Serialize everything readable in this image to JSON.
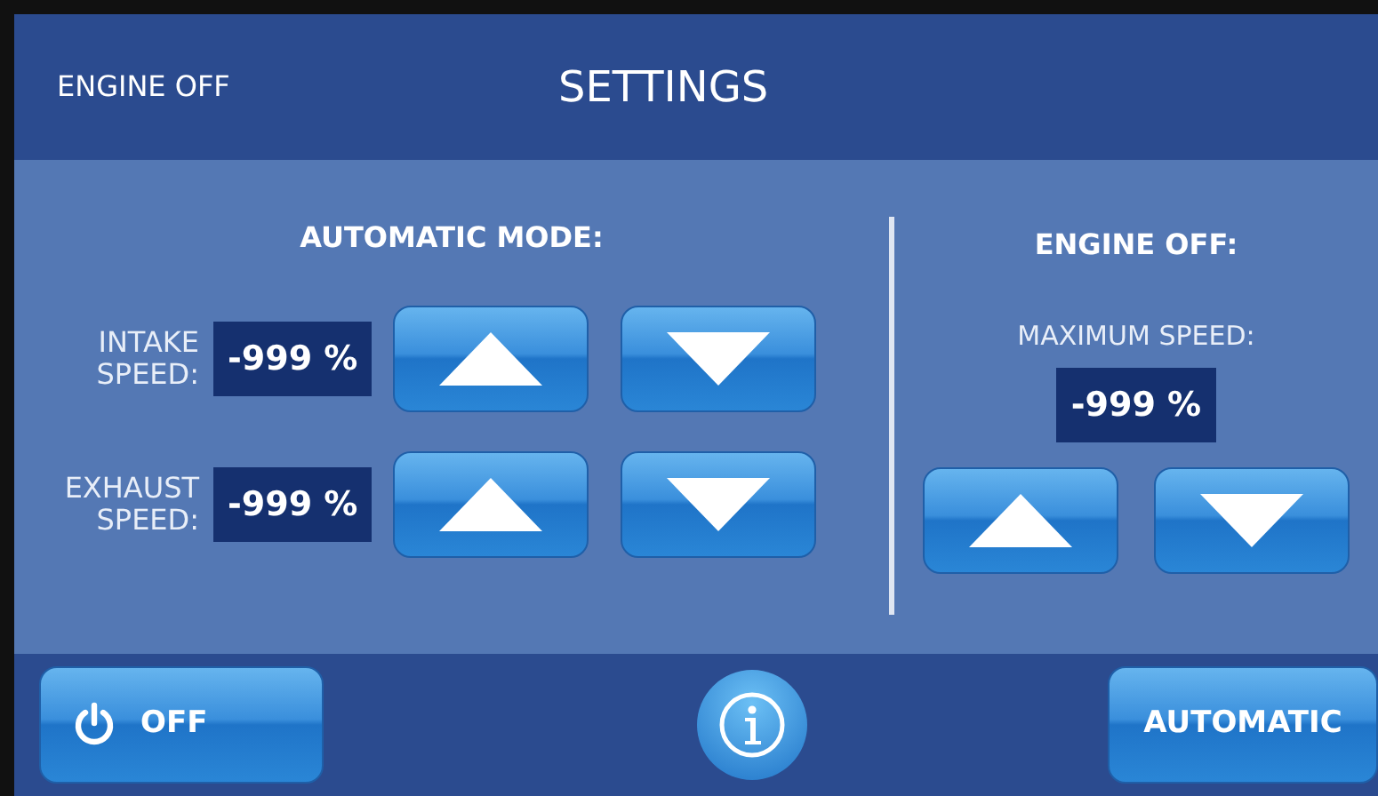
{
  "header": {
    "status": "ENGINE OFF",
    "title": "SETTINGS"
  },
  "automatic_mode": {
    "title": "AUTOMATIC MODE:",
    "rows": [
      {
        "label": "INTAKE SPEED:",
        "value": "-999 %"
      },
      {
        "label": "EXHAUST SPEED:",
        "value": "-999 %"
      }
    ]
  },
  "engine_off": {
    "title": "ENGINE OFF:",
    "label": "MAXIMUM SPEED:",
    "value": "-999 %"
  },
  "footer": {
    "off_button": "OFF",
    "automatic_button": "AUTOMATIC"
  }
}
